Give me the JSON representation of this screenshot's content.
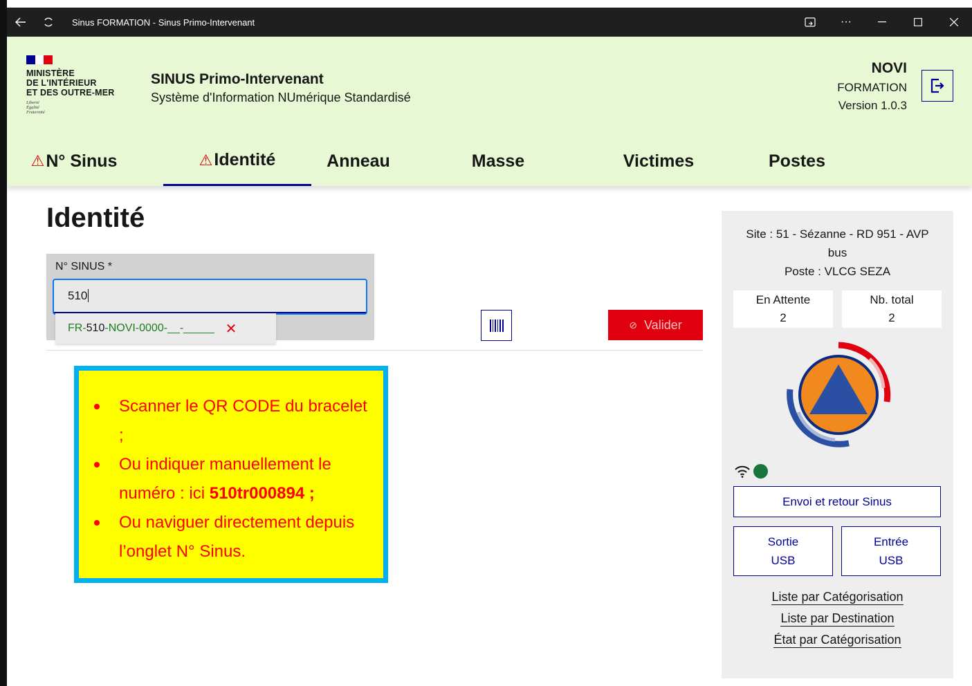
{
  "window": {
    "title": "Sinus FORMATION - Sinus Primo-Intervenant",
    "back_icon": "arrow-left-icon",
    "refresh_icon": "refresh-icon",
    "controls": [
      "cast-icon",
      "more-icon",
      "minimize-icon",
      "maximize-icon",
      "close-icon"
    ]
  },
  "header": {
    "logo_lines": [
      "MINISTÈRE",
      "DE L'INTÉRIEUR",
      "ET DES OUTRE-MER"
    ],
    "motto": [
      "Liberté",
      "Égalité",
      "Fraternité"
    ],
    "app_title": "SINUS Primo-Intervenant",
    "app_subtitle": "Système d'Information NUmérique Standardisé",
    "app_name": "NOVI",
    "mode": "FORMATION",
    "version": "Version 1.0.3",
    "colors": {
      "background": "#e8f8d4",
      "flag_blue": "#000091",
      "flag_red": "#e1000f"
    }
  },
  "nav": {
    "tabs": [
      {
        "label": "N° Sinus",
        "warning": "⚠"
      },
      {
        "label": "Identité",
        "warning": "⚠",
        "active": true
      },
      {
        "label": "Anneau"
      },
      {
        "label": "Masse"
      },
      {
        "label": "Victimes"
      },
      {
        "label": "Postes"
      }
    ]
  },
  "main": {
    "title": "Identité",
    "sinus_field": {
      "label": "N° SINUS *",
      "value": "510",
      "suggestion": {
        "prefix": "FR-",
        "digits": "510",
        "rest": "-NOVI-0000-__-_____"
      }
    },
    "scan_icon": "barcode-icon",
    "validate_label": "Valider",
    "validate_icon": "check-circle-icon"
  },
  "annotation": {
    "items": [
      {
        "text": "Scanner le QR CODE du bracelet ;"
      },
      {
        "text": "Ou indiquer manuellement le numéro : ici ",
        "bold": "510tr000894 ;"
      },
      {
        "text": "Ou naviguer directement depuis l’onglet N° Sinus."
      }
    ],
    "colors": {
      "background": "#ffff00",
      "border": "#00b0f0",
      "text": "#ff0000"
    }
  },
  "sidebar": {
    "site_lines": [
      "Site : 51 - Sézanne - RD 951 - AVP",
      "bus",
      "Poste : VLCG SEZA"
    ],
    "stats": [
      {
        "label": "En Attente",
        "value": "2"
      },
      {
        "label": "Nb. total",
        "value": "2"
      }
    ],
    "emblem_icon": "securite-civile-emblem-icon",
    "wifi_icon": "wifi-icon",
    "connection_status": "online",
    "send_button": "Envoi et retour Sinus",
    "usb_out": [
      "Sortie",
      "USB"
    ],
    "usb_in": [
      "Entrée",
      "USB"
    ],
    "links": [
      "Liste par Catégorisation",
      "Liste par Destination",
      "État par Catégorisation"
    ]
  }
}
